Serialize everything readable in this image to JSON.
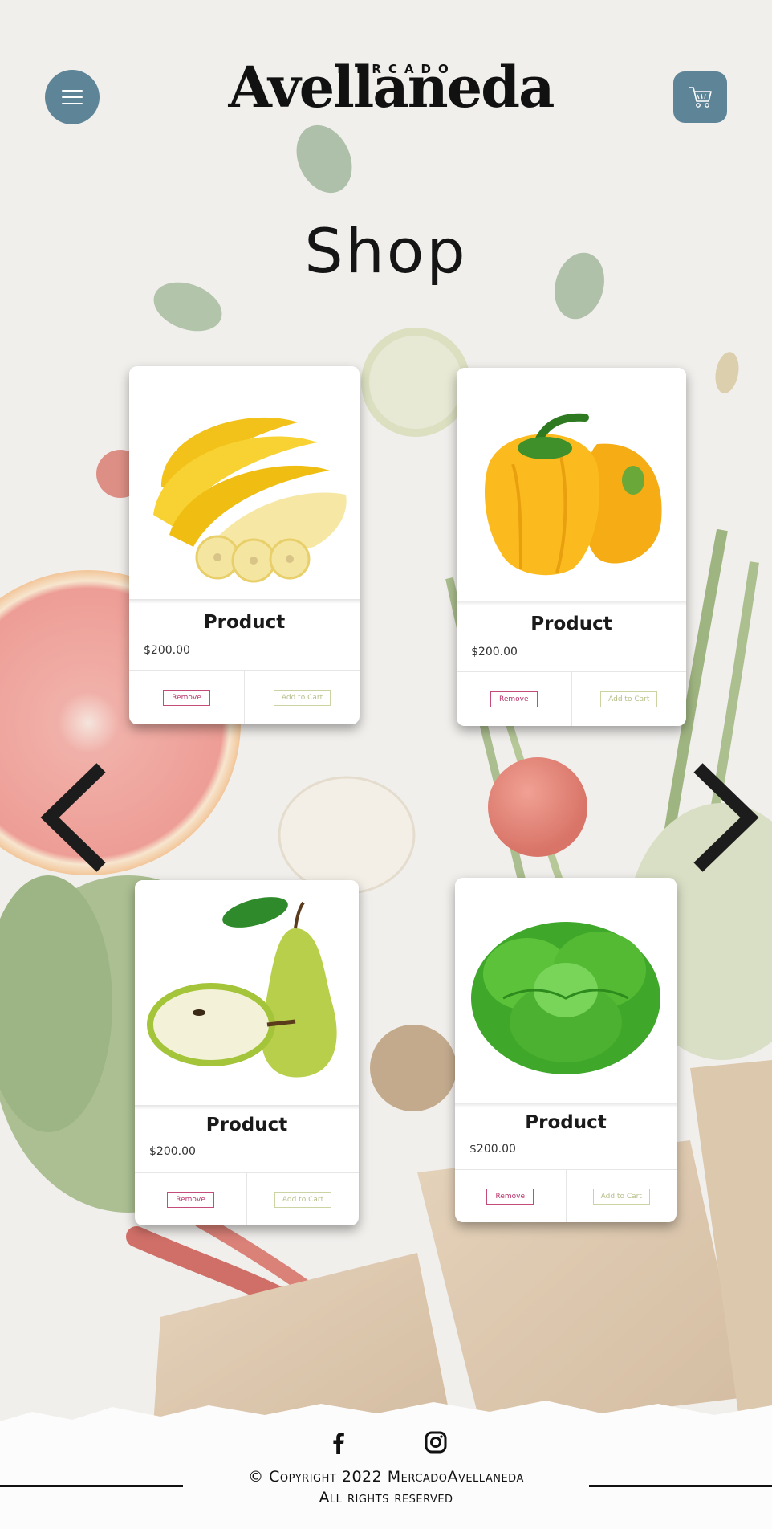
{
  "header": {
    "logo_small": "MERCADO",
    "logo_big": "Avellaneda",
    "menu_icon": "hamburger-menu-icon",
    "cart_icon": "shopping-cart-icon"
  },
  "page": {
    "title": "Shop"
  },
  "products": [
    {
      "name": "Product",
      "price": "$200.00",
      "remove_label": "Remove",
      "add_label": "Add to Cart",
      "image": "bananas"
    },
    {
      "name": "Product",
      "price": "$200.00",
      "remove_label": "Remove",
      "add_label": "Add to Cart",
      "image": "yellow-peppers"
    },
    {
      "name": "Product",
      "price": "$200.00",
      "remove_label": "Remove",
      "add_label": "Add to Cart",
      "image": "pears"
    },
    {
      "name": "Product",
      "price": "$200.00",
      "remove_label": "Remove",
      "add_label": "Add to Cart",
      "image": "lettuce"
    }
  ],
  "carousel": {
    "prev_icon": "chevron-left-icon",
    "next_icon": "chevron-right-icon"
  },
  "footer": {
    "social": [
      "facebook-icon",
      "instagram-icon"
    ],
    "copyright_line1": "© Copyright 2022 MercadoAvellaneda",
    "copyright_line2": "All rights reserved"
  },
  "colors": {
    "accent": "#5e8498",
    "remove": "#c34c7a",
    "add_to_cart": "#cbd3a2",
    "background": "#f1efec"
  }
}
